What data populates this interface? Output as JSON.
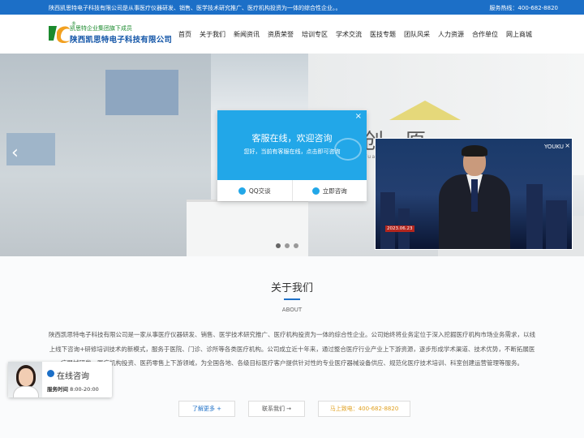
{
  "topbar": {
    "intro": "陕西凯思特电子科技有限公司是从事医疗仪器研发、销售、医学技术研究推广、医疗机构投资为一体的综合性企业。。",
    "hotline": "服务热线：400-682-8820"
  },
  "logo": {
    "tagline": "凯思特企业集团旗下成员",
    "name": "陕西凯思特电子科技有限公司",
    "reg_mark": "®"
  },
  "nav": {
    "items": [
      "首页",
      "关于我们",
      "新闻资讯",
      "资质荣誉",
      "培训专区",
      "学术交流",
      "医技专题",
      "团队风采",
      "人力资源",
      "合作单位",
      "网上商城"
    ]
  },
  "banner": {
    "sign": "秦创原",
    "sign_sub": "QinChuangYuan Platform",
    "prev_icon": "‹",
    "next_icon": "›",
    "slide_count": 3,
    "active_slide": 0
  },
  "video": {
    "watermark": "YOUKU",
    "date_label": "2023.06.23",
    "close_icon": "×"
  },
  "chat_popup": {
    "title": "客服在线，欢迎咨询",
    "subtitle": "您好，当前有客服在线，点击即可咨询",
    "qq_label": "QQ交谈",
    "consult_label": "立即咨询",
    "close_icon": "×"
  },
  "about": {
    "title": "关于我们",
    "subtitle": "ABOUT",
    "text": "陕西凯思特电子科技有限公司是一家从事医疗仪器研发、销售、医学技术研究推广、医疗机构投资为一体的综合性企业。公司始终将业务定位于深入挖掘医疗机构市场业务需求，以线上线下咨询+研修培训技术的新模式，服务于医院、门诊、诊所等各类医疗机构。公司成立近十年来，通过整合医疗行业产业上下游资源，逐步形成学术渠道、技术优势，不断拓展医疗器械研发、医疗机构投资、医药零售上下游领域，为全国各地、各级目标医疗客户提供针对性的专业医疗器械设备供应、规范化医疗技术培训、科室创建运营管理等服务。",
    "more_label": "了解更多 +",
    "contact_label": "联系我们 →",
    "call_label": "马上致电：400-682-8820"
  },
  "float_widget": {
    "label": "在线咨询",
    "hours_prefix": "服务时间",
    "hours": " 8:00-20:00"
  },
  "colors": {
    "brand_blue": "#1c6fc7",
    "chat_blue": "#22a7e8",
    "logo_green": "#1b8a2e",
    "call_orange": "#e0a020"
  }
}
